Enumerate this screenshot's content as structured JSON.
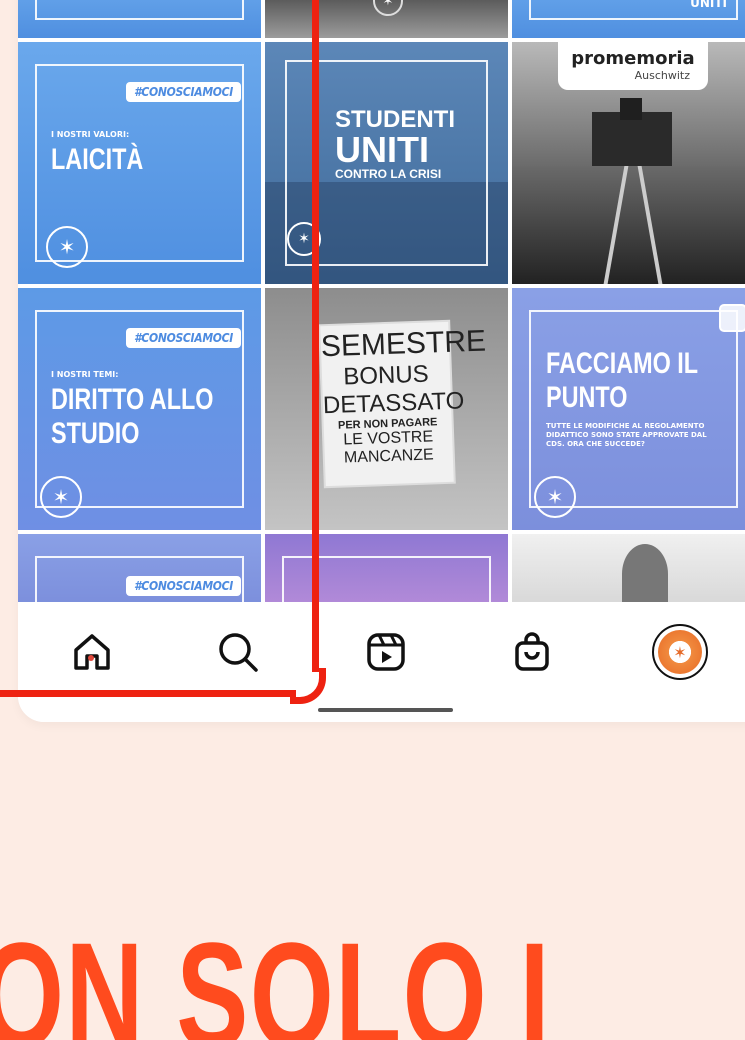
{
  "grid": {
    "tiles": [
      {
        "kind": "blue-post",
        "tag": "",
        "small": "",
        "big": ""
      },
      {
        "kind": "photo",
        "tag": "",
        "small": "",
        "big": ""
      },
      {
        "kind": "blue-post",
        "tag": "",
        "small": "",
        "big": "UNITI"
      },
      {
        "kind": "blue-post",
        "tag": "#CONOSCIAMOCI",
        "small": "I NOSTRI VALORI:",
        "big": "LAICITÀ"
      },
      {
        "kind": "overlay-photo",
        "big_lines": [
          "STUDENTI",
          "UNITI",
          "CONTRO LA CRISI"
        ]
      },
      {
        "kind": "bw-photo",
        "badge": "promemoria",
        "badge_sub": "Auschwitz"
      },
      {
        "kind": "blue-post",
        "tag": "#CONOSCIAMOCI",
        "small": "I NOSTRI TEMI:",
        "big_lines": [
          "DIRITTO ALLO",
          "STUDIO"
        ]
      },
      {
        "kind": "bw-photo",
        "sign_lines": [
          "SEMESTRE",
          "BONUS",
          "DETASSATO",
          "PER NON PAGARE",
          "LE VOSTRE",
          "MANCANZE"
        ]
      },
      {
        "kind": "blue-post",
        "big_lines": [
          "FACCIAMO IL",
          "PUNTO"
        ],
        "sub": "TUTTE LE MODIFICHE AL REGOLAMENTO DIDATTICO SONO STATE APPROVATE DAL CDS. ORA CHE SUCCEDE?"
      },
      {
        "kind": "blue-post",
        "tag": "#CONOSCIAMOCI"
      },
      {
        "kind": "purple-photo"
      },
      {
        "kind": "photo-person"
      }
    ]
  },
  "nav": {
    "items": [
      {
        "name": "home-icon"
      },
      {
        "name": "search-icon"
      },
      {
        "name": "reels-icon"
      },
      {
        "name": "shop-icon"
      },
      {
        "name": "profile-avatar"
      }
    ]
  },
  "headline": "ON SOLO IL FEED",
  "colors": {
    "accent": "#ff4b1e",
    "line": "#ee2211",
    "background": "#fdece4"
  }
}
